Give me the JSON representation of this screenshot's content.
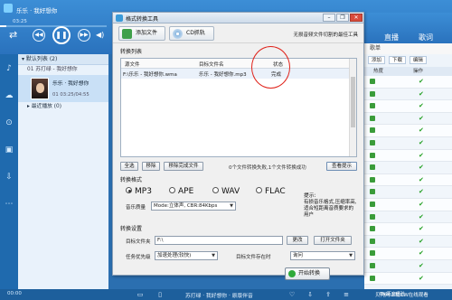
{
  "player": {
    "now_playing": "乐乐 · 我好想你",
    "time": "03:25",
    "progress_fraction": 0.06,
    "top_song_display": "我好想你 · 苏打绿",
    "playlist": {
      "header": "▾ 默认列表 (2)",
      "row1": "01 苏打绿 - 我好想你",
      "active_title": "乐乐 · 我好想你",
      "active_time": "01 03:25/04:55",
      "footer": "▸ 最近播放 (0)"
    },
    "right_panel": {
      "tab_live": "直播",
      "tab_lyrics": "歌词",
      "header": "歌单",
      "btn_add": "添加",
      "btn_download": "下载",
      "btn_more": "编辑",
      "col_hot": "热度",
      "col_op": "操作"
    },
    "bottom": {
      "time": "00:00",
      "song": "苏打绿 · 我好想你 · 原版伴音",
      "status": "贝壳网上载CW在线观看"
    }
  },
  "dialog": {
    "title": "格式转换工具",
    "btn_add_file": "添加文件",
    "btn_cd": "CD抓轨",
    "slogan": "无损音频文件切割的最佳工具",
    "list_section": "转换列表",
    "columns": {
      "source": "源文件",
      "target": "目标文件名",
      "status": "状态"
    },
    "file": {
      "source": "F:\\乐乐 - 我好想你.wma",
      "target": "乐乐 - 我好想你.mp3",
      "status": "完成"
    },
    "btn_select_all": "全选",
    "btn_remove": "移除",
    "btn_remove_done": "移除完成文件",
    "summary": "0个文件转换失败,1个文件转换成功",
    "btn_detail": "查看提示",
    "format_section": "转换格式",
    "formats": {
      "mp3": "MP3",
      "ape": "APE",
      "wav": "WAV",
      "flac": "FLAC"
    },
    "quality_label": "音乐质量",
    "quality_value": "Mode:立体声, CBR:84Kbps",
    "hint_title": "提示:",
    "hint_text": "有损音乐格式,压缩率高,适合短距离音质要求的用户",
    "settings_section": "转换设置",
    "target_folder_label": "目标文件夹",
    "target_folder_value": "F:\\",
    "btn_change": "更改",
    "btn_open_folder": "打开文件夹",
    "priority_label": "任务优先级",
    "priority_value": "加速处理(较快)",
    "exists_label": "目标文件存在时",
    "exists_value": "询问",
    "btn_start": "开始转换"
  },
  "watermark": "Bai百度经验"
}
